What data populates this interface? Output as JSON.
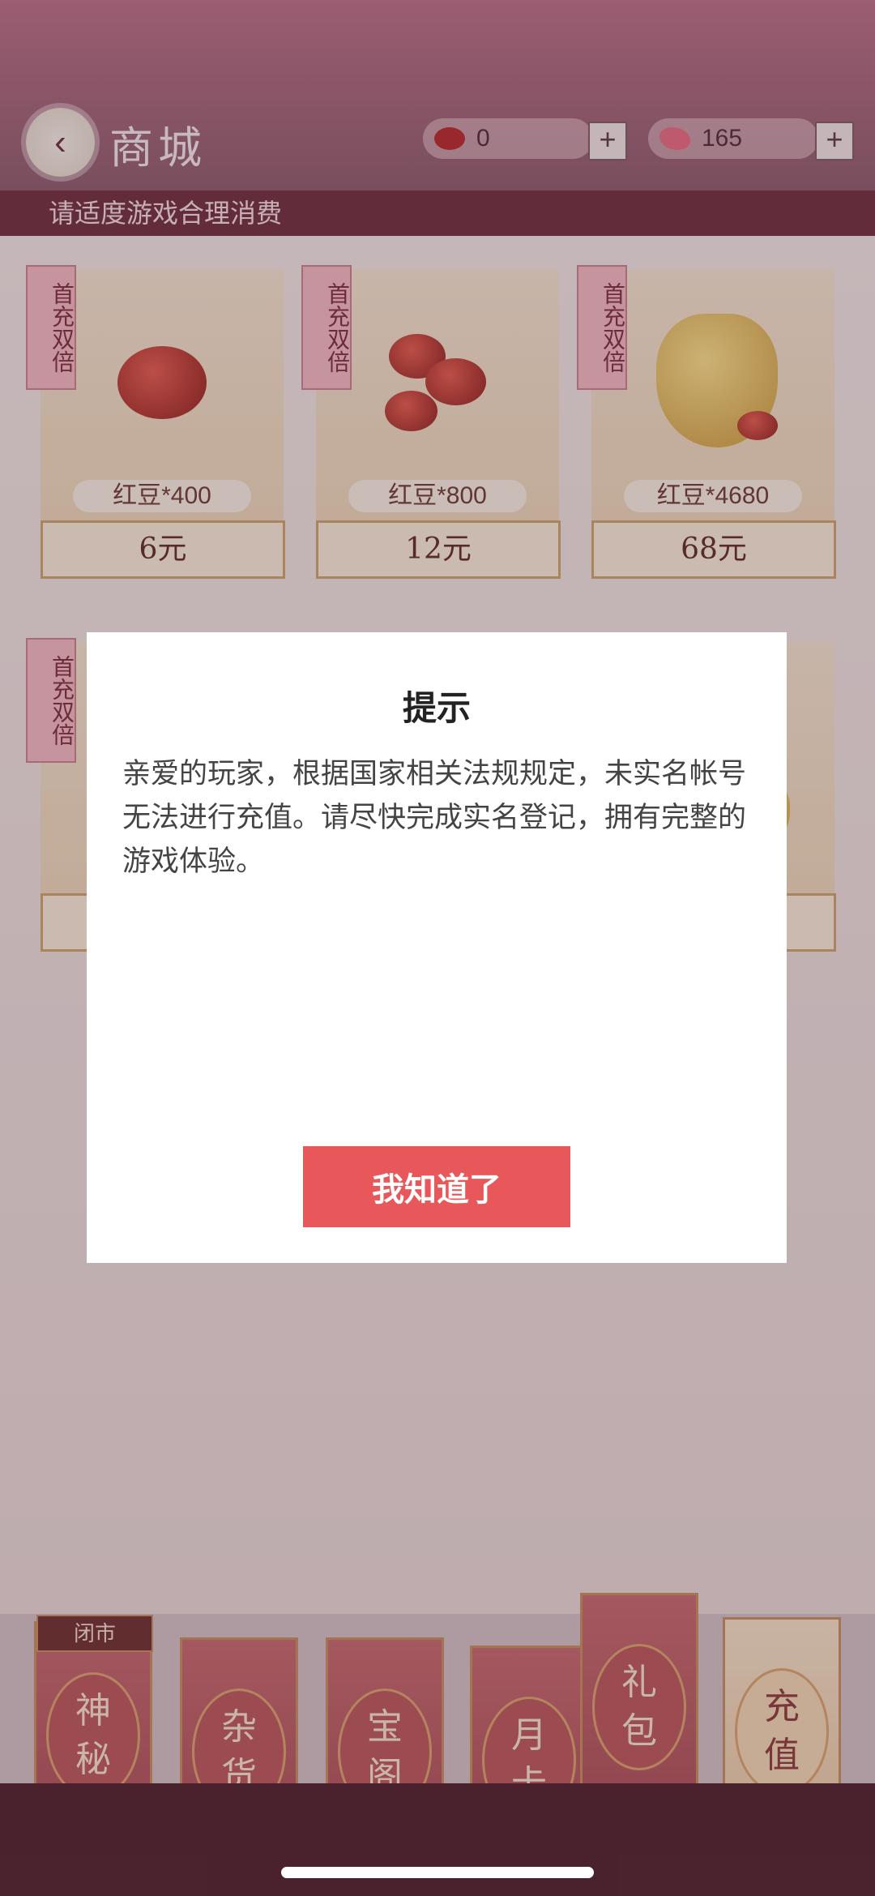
{
  "header": {
    "title": "商城",
    "back_icon": "chevron-left-icon",
    "currencies": [
      {
        "icon": "red-bean-icon",
        "value": "0",
        "plus": "+"
      },
      {
        "icon": "butterfly-icon",
        "value": "165",
        "plus": "+"
      }
    ]
  },
  "notice": "请适度游戏合理消费",
  "products": [
    {
      "tag": "首充双倍",
      "name": "红豆*400",
      "price": "6元"
    },
    {
      "tag": "首充双倍",
      "name": "红豆*800",
      "price": "12元"
    },
    {
      "tag": "首充双倍",
      "name": "红豆*4680",
      "price": "68元"
    },
    {
      "tag": "首充双倍",
      "name": "",
      "price": ""
    }
  ],
  "dialog": {
    "title": "提示",
    "message": "亲爱的玩家，根据国家相关法规规定，未实名帐号无法进行充值。请尽快完成实名登记，拥有完整的游戏体验。",
    "button": "我知道了"
  },
  "nav": {
    "closed_badge": "闭市",
    "items": [
      {
        "top": "神",
        "bottom": "秘"
      },
      {
        "top": "杂",
        "bottom": "货"
      },
      {
        "top": "宝",
        "bottom": "阁"
      },
      {
        "top": "月",
        "bottom": "卡"
      },
      {
        "top": "礼",
        "bottom": "包"
      },
      {
        "top": "充",
        "bottom": "值"
      }
    ]
  },
  "colors": {
    "accent": "#e8575a",
    "header": "#8a5a6a",
    "notice_bar": "#6d2c3d"
  }
}
